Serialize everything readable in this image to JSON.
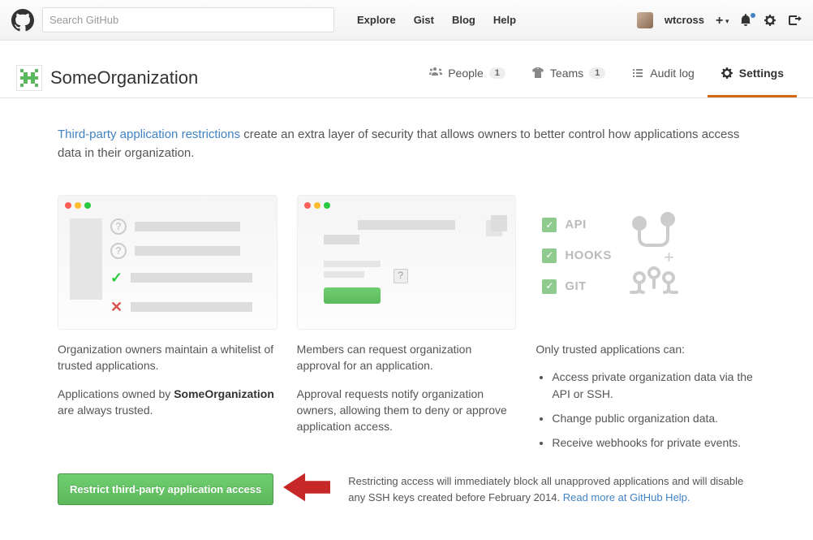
{
  "search_placeholder": "Search GitHub",
  "nav": {
    "explore": "Explore",
    "gist": "Gist",
    "blog": "Blog",
    "help": "Help"
  },
  "user": {
    "name": "wtcross"
  },
  "org": {
    "name": "SomeOrganization",
    "tabs": {
      "people": {
        "label": "People",
        "count": "1"
      },
      "teams": {
        "label": "Teams",
        "count": "1"
      },
      "audit": {
        "label": "Audit log"
      },
      "settings": {
        "label": "Settings"
      }
    }
  },
  "intro": {
    "link": "Third-party application restrictions",
    "rest": " create an extra layer of security that allows owners to better control how applications access data in their organization."
  },
  "col1": {
    "p1": "Organization owners maintain a whitelist of trusted applications.",
    "p2a": "Applications owned by ",
    "p2b": "SomeOrganization",
    "p2c": " are always trusted."
  },
  "col2": {
    "p1": "Members can request organization approval for an application.",
    "p2": "Approval requests notify organization owners, allowing them to deny or approve application access."
  },
  "col3": {
    "title": "Only trusted applications can:",
    "items": {
      "i1": "Access private organization data via the API or SSH.",
      "i2": "Change public organization data.",
      "i3": "Receive webhooks for private events."
    },
    "check_labels": {
      "api": "API",
      "hooks": "HOOKS",
      "git": "GIT"
    }
  },
  "bottom": {
    "button": "Restrict third-party application access",
    "warn_a": "Restricting access will immediately block all unapproved applications and will disable any SSH keys created before February 2014. ",
    "warn_link": "Read more at GitHub Help."
  }
}
